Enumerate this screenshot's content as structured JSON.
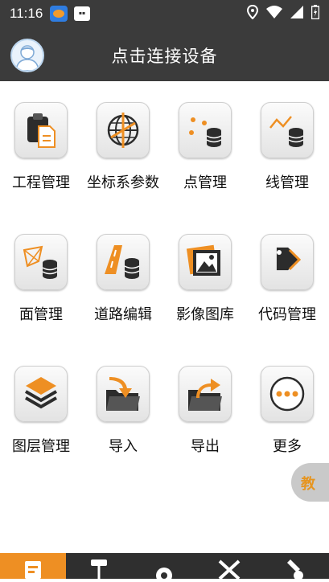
{
  "status_bar": {
    "time": "11:16",
    "icons": [
      "app-notification-icon",
      "app-notification-icon",
      "location-icon",
      "wifi-icon",
      "signal-icon",
      "battery-icon"
    ]
  },
  "header": {
    "title": "点击连接设备",
    "avatar_icon": "user-avatar-icon"
  },
  "menu": [
    {
      "label": "工程管理",
      "icon": "project-clipboard-icon"
    },
    {
      "label": "坐标系参数",
      "icon": "globe-compass-icon"
    },
    {
      "label": "点管理",
      "icon": "points-database-icon"
    },
    {
      "label": "线管理",
      "icon": "line-database-icon"
    },
    {
      "label": "面管理",
      "icon": "polygon-database-icon"
    },
    {
      "label": "道路编辑",
      "icon": "road-database-icon"
    },
    {
      "label": "影像图库",
      "icon": "image-gallery-icon"
    },
    {
      "label": "代码管理",
      "icon": "tag-icon"
    },
    {
      "label": "图层管理",
      "icon": "layers-icon"
    },
    {
      "label": "导入",
      "icon": "import-folder-icon"
    },
    {
      "label": "导出",
      "icon": "export-folder-icon"
    },
    {
      "label": "更多",
      "icon": "more-dots-icon"
    }
  ],
  "float_button": {
    "label": "教"
  },
  "bottom_nav": [
    {
      "icon": "project-icon",
      "active": true
    },
    {
      "icon": "survey-instrument-icon",
      "active": false
    },
    {
      "icon": "settings-gear-icon",
      "active": false
    },
    {
      "icon": "tools-icon",
      "active": false
    },
    {
      "icon": "wrench-person-icon",
      "active": false
    }
  ],
  "colors": {
    "accent": "#ee8f23",
    "header_bg": "#3b3b3b",
    "tile_bg": "#eeeeee"
  }
}
